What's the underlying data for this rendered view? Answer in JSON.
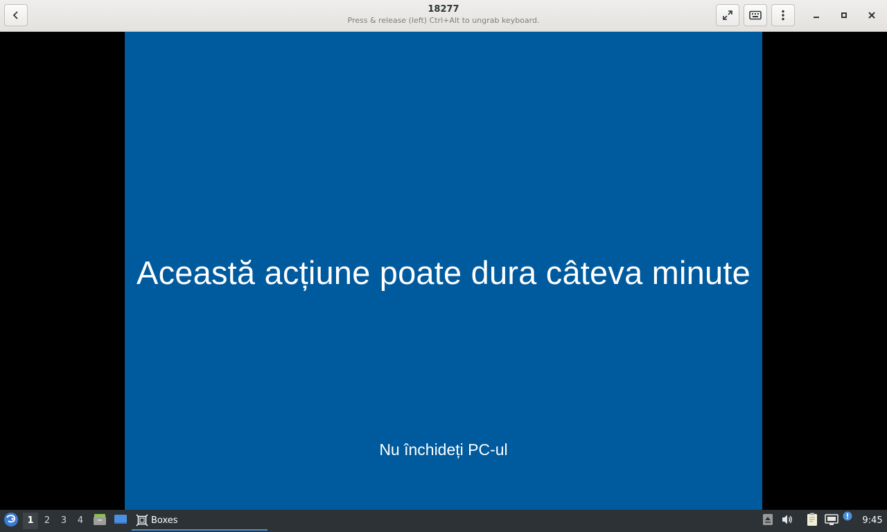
{
  "window": {
    "title": "18277",
    "subtitle": "Press & release (left) Ctrl+Alt to ungrab keyboard.",
    "buttons": {
      "back_icon": "chevron-left-icon",
      "fullscreen_icon": "expand-icon",
      "keyboard_icon": "keyboard-icon",
      "menu_icon": "vertical-dots-icon",
      "minimize_icon": "minimize-icon",
      "maximize_icon": "maximize-icon",
      "close_icon": "close-icon"
    }
  },
  "vm": {
    "background_color": "#005a9e",
    "heading": "Această acțiune poate dura câteva minute",
    "subtext": "Nu închideți PC-ul"
  },
  "taskbar": {
    "workspaces": [
      "1",
      "2",
      "3",
      "4"
    ],
    "active_workspace": "1",
    "launchers": [
      "file-manager-icon",
      "desktop-icon"
    ],
    "tasks": [
      {
        "label": "Boxes",
        "icon": "boxes-icon",
        "active": true
      }
    ],
    "tray": [
      "arrow-up-icon",
      "volume-icon",
      "clipboard-icon",
      "network-icon",
      "notification-icon"
    ],
    "clock": "9:45",
    "accent_color": "#4a90d9"
  }
}
